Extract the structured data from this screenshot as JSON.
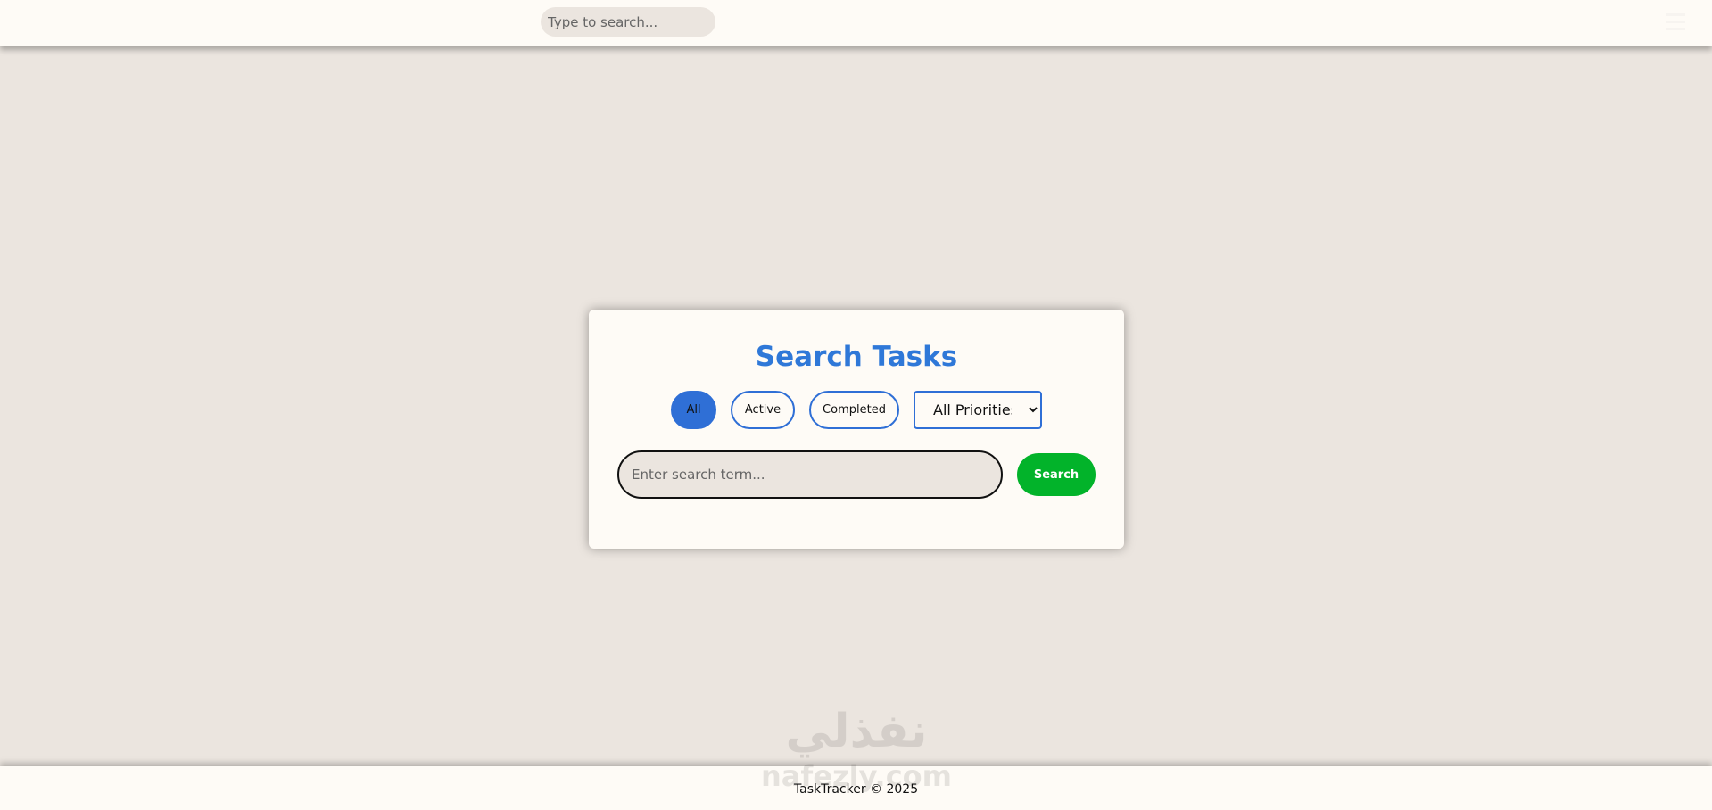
{
  "header": {
    "search_placeholder": "Type to search..."
  },
  "search_card": {
    "title": "Search Tasks",
    "filters": [
      {
        "label": "All",
        "active": true
      },
      {
        "label": "Active",
        "active": false
      },
      {
        "label": "Completed",
        "active": false
      }
    ],
    "priority_select": {
      "selected": "All Priorities"
    },
    "search_placeholder": "Enter search term...",
    "search_button_label": "Search"
  },
  "footer": {
    "text": "TaskTracker © 2025"
  },
  "watermark": {
    "arabic": "نفذلي",
    "latin": "nafezly.com"
  },
  "colors": {
    "accent_blue": "#2f6fd6",
    "title_blue": "#2f78d8",
    "search_green": "#02b32a",
    "background": "#ebe5df",
    "surface": "#fefbf6"
  },
  "icons": {
    "select_arrow": "chevron-down-icon"
  }
}
